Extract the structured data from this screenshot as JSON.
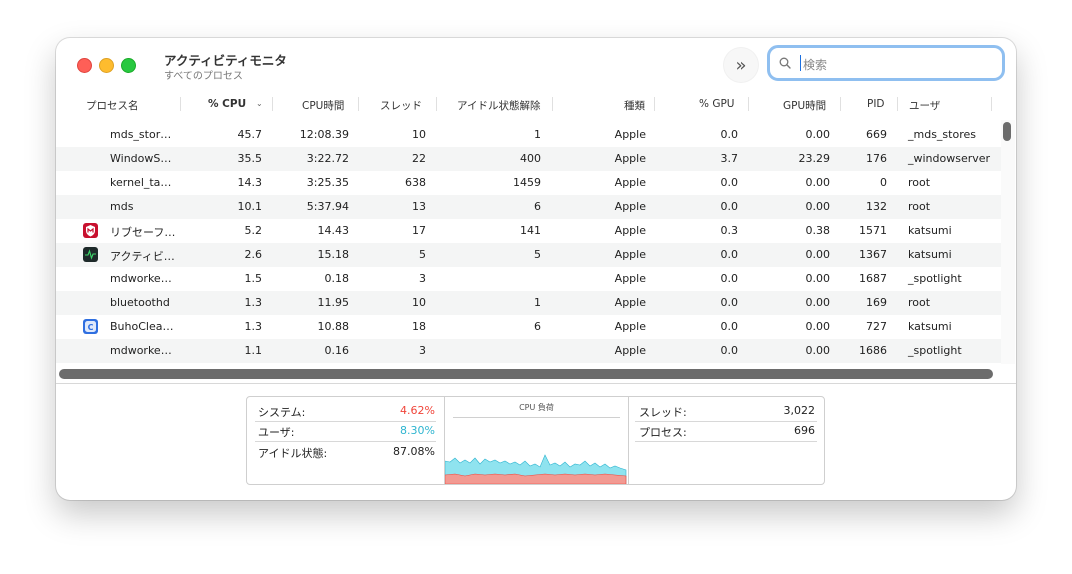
{
  "window": {
    "title": "アクティビティモニタ",
    "subtitle": "すべてのプロセス"
  },
  "toolbar": {
    "more_label": "»",
    "search_placeholder": "検索"
  },
  "columns": [
    "プロセス名",
    "% CPU",
    "CPU時間",
    "スレッド",
    "アイドル状態解除",
    "種類",
    "% GPU",
    "GPU時間",
    "PID",
    "ユーザ"
  ],
  "rows": [
    {
      "icon": "",
      "name": "mds_stor…",
      "cpu": "45.7",
      "cpu_time": "12:08.39",
      "threads": "10",
      "idle_wakeups": "1",
      "kind": "Apple",
      "gpu": "0.0",
      "gpu_time": "0.00",
      "pid": "669",
      "user": "_mds_stores"
    },
    {
      "icon": "",
      "name": "WindowS…",
      "cpu": "35.5",
      "cpu_time": "3:22.72",
      "threads": "22",
      "idle_wakeups": "400",
      "kind": "Apple",
      "gpu": "3.7",
      "gpu_time": "23.29",
      "pid": "176",
      "user": "_windowserver"
    },
    {
      "icon": "",
      "name": "kernel_ta…",
      "cpu": "14.3",
      "cpu_time": "3:25.35",
      "threads": "638",
      "idle_wakeups": "1459",
      "kind": "Apple",
      "gpu": "0.0",
      "gpu_time": "0.00",
      "pid": "0",
      "user": "root"
    },
    {
      "icon": "",
      "name": "mds",
      "cpu": "10.1",
      "cpu_time": "5:37.94",
      "threads": "13",
      "idle_wakeups": "6",
      "kind": "Apple",
      "gpu": "0.0",
      "gpu_time": "0.00",
      "pid": "132",
      "user": "root"
    },
    {
      "icon": "mcafee-shield-icon",
      "name": "リブセーフ…",
      "cpu": "5.2",
      "cpu_time": "14.43",
      "threads": "17",
      "idle_wakeups": "141",
      "kind": "Apple",
      "gpu": "0.3",
      "gpu_time": "0.38",
      "pid": "1571",
      "user": "katsumi"
    },
    {
      "icon": "activity-monitor-icon",
      "name": "アクティビ…",
      "cpu": "2.6",
      "cpu_time": "15.18",
      "threads": "5",
      "idle_wakeups": "5",
      "kind": "Apple",
      "gpu": "0.0",
      "gpu_time": "0.00",
      "pid": "1367",
      "user": "katsumi"
    },
    {
      "icon": "",
      "name": "mdworke…",
      "cpu": "1.5",
      "cpu_time": "0.18",
      "threads": "3",
      "idle_wakeups": "",
      "kind": "Apple",
      "gpu": "0.0",
      "gpu_time": "0.00",
      "pid": "1687",
      "user": "_spotlight"
    },
    {
      "icon": "",
      "name": "bluetoothd",
      "cpu": "1.3",
      "cpu_time": "11.95",
      "threads": "10",
      "idle_wakeups": "1",
      "kind": "Apple",
      "gpu": "0.0",
      "gpu_time": "0.00",
      "pid": "169",
      "user": "root"
    },
    {
      "icon": "buhocleaner-icon",
      "name": "BuhoClea…",
      "cpu": "1.3",
      "cpu_time": "10.88",
      "threads": "18",
      "idle_wakeups": "6",
      "kind": "Apple",
      "gpu": "0.0",
      "gpu_time": "0.00",
      "pid": "727",
      "user": "katsumi"
    },
    {
      "icon": "",
      "name": "mdworke…",
      "cpu": "1.1",
      "cpu_time": "0.16",
      "threads": "3",
      "idle_wakeups": "",
      "kind": "Apple",
      "gpu": "0.0",
      "gpu_time": "0.00",
      "pid": "1686",
      "user": "_spotlight"
    }
  ],
  "stats": {
    "system_label": "システム:",
    "system_value": "4.62%",
    "user_label": "ユーザ:",
    "user_value": "8.30%",
    "idle_label": "アイドル状態:",
    "idle_value": "87.08%",
    "graph_title": "CPU 負荷",
    "threads_label": "スレッド:",
    "threads_value": "3,022",
    "processes_label": "プロセス:",
    "processes_value": "696"
  },
  "colors": {
    "system": "#f0453a",
    "user": "#2fb5d0",
    "search_focus": "#8fbff0"
  }
}
